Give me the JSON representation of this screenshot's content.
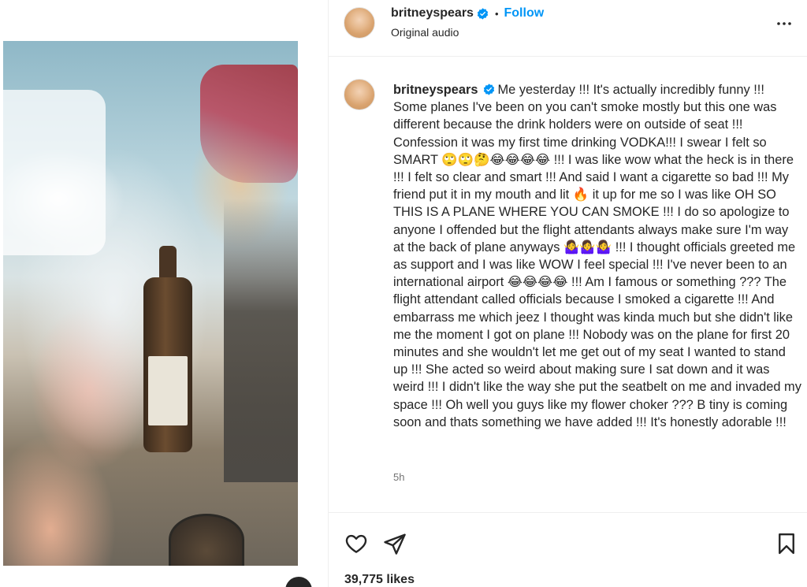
{
  "header": {
    "username": "britneyspears",
    "follow_label": "Follow",
    "audio_label": "Original audio"
  },
  "caption": {
    "username": "britneyspears",
    "text": "Me yesterday !!! It's actually incredibly funny !!! Some planes I've been on you can't smoke mostly but this one was different because the drink holders were on outside of seat !!! Confession it was my first time drinking VODKA!!! I swear I felt so SMART 🙄🙄🤔😂😂😂😂 !!! I was like wow what the heck is in there !!! I felt so clear and smart !!! And said I want a cigarette so bad !!! My friend put it in my mouth and lit 🔥 it up for me so I was like OH SO THIS IS A PLANE WHERE YOU CAN SMOKE !!! I do so apologize to anyone I offended but the flight attendants always make sure I'm way at the back of plane anyways 🤷‍♀️🤷‍♀️🤷‍♀️ !!! I thought officials greeted me as support and I was like WOW I feel special !!! I've never been to an international airport 😂😂😂😂 !!! Am I famous or something ??? The flight attendant called officials because I smoked a cigarette !!! And embarrass me which jeez I thought was kinda much but she didn't like me the moment I got on plane !!! Nobody was on the plane for first 20 minutes and she wouldn't let me get out of my seat I wanted to stand up !!! She acted so weird about making sure I sat down and it was weird !!! I didn't like the way she put the seatbelt on me and invaded my space !!! Oh well you guys like my flower choker ??? B tiny is coming soon and thats something we have added !!! It's honestly adorable !!!",
    "time": "5h"
  },
  "actions": {
    "likes": "39,775 likes"
  },
  "icons": {
    "verified": "verified-badge-icon",
    "more": "more-options-icon",
    "like": "heart-icon",
    "share": "paper-plane-icon",
    "save": "bookmark-icon"
  },
  "colors": {
    "accent": "#0095f6",
    "text": "#262626",
    "muted": "#737373",
    "divider": "#efefef"
  }
}
